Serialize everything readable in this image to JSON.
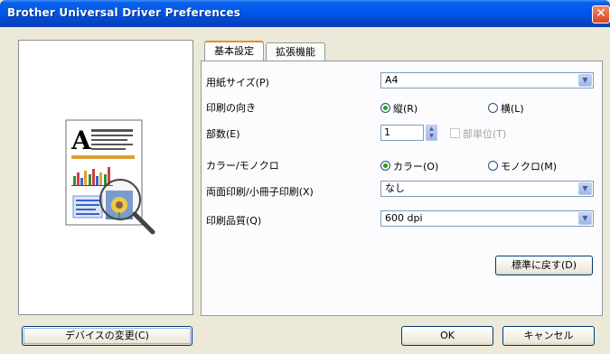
{
  "window": {
    "title": "Brother Universal Driver Preferences",
    "close_glyph": "✕"
  },
  "tabs": [
    {
      "label": "基本設定"
    },
    {
      "label": "拡張機能"
    }
  ],
  "settings": {
    "paper_size": {
      "label": "用紙サイズ(P)",
      "value": "A4"
    },
    "orientation": {
      "label": "印刷の向き",
      "options": [
        "縦(R)",
        "横(L)"
      ],
      "selected": "縦(R)"
    },
    "copies": {
      "label": "部数(E)",
      "value": "1",
      "collate_label": "部単位(T)",
      "collate_enabled": false
    },
    "color_mode": {
      "label": "カラー/モノクロ",
      "options": [
        "カラー(O)",
        "モノクロ(M)"
      ],
      "selected": "カラー(O)"
    },
    "duplex": {
      "label": "両面印刷/小冊子印刷(X)",
      "value": "なし"
    },
    "quality": {
      "label": "印刷品質(Q)",
      "value": "600 dpi"
    }
  },
  "buttons": {
    "restore_defaults": "標準に戻す(D)",
    "change_device": "デバイスの変更(C)",
    "ok": "OK",
    "cancel": "キャンセル"
  },
  "preview": {
    "letter": "A",
    "icon": "printer-preview-magnifier-icon"
  },
  "colors": {
    "titlebar": "#0058ee",
    "accent_tab": "#e68b2c",
    "face": "#ece9d8"
  }
}
